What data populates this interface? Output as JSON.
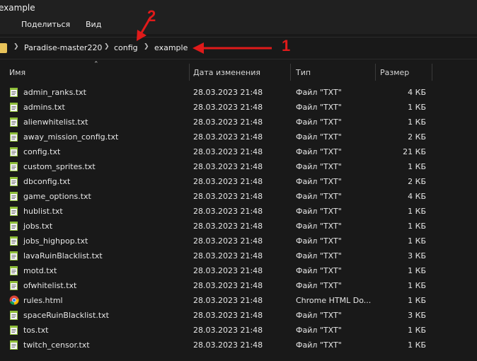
{
  "window": {
    "title": "example"
  },
  "menu": {
    "share": "Поделиться",
    "view": "Вид"
  },
  "breadcrumb": [
    "Paradise-master220",
    "config",
    "example"
  ],
  "annotations": {
    "one": "1",
    "two": "2"
  },
  "colors": {
    "annotation": "#e01a1a",
    "folder": "#e8c35a"
  },
  "columns": {
    "name": "Имя",
    "date": "Дата изменения",
    "type": "Тип",
    "size": "Размер"
  },
  "files": [
    {
      "name": "admin_ranks.txt",
      "date": "28.03.2023 21:48",
      "type": "Файл \"TXT\"",
      "size": "4 КБ",
      "icon": "text-file-icon"
    },
    {
      "name": "admins.txt",
      "date": "28.03.2023 21:48",
      "type": "Файл \"TXT\"",
      "size": "1 КБ",
      "icon": "text-file-icon"
    },
    {
      "name": "alienwhitelist.txt",
      "date": "28.03.2023 21:48",
      "type": "Файл \"TXT\"",
      "size": "1 КБ",
      "icon": "text-file-icon"
    },
    {
      "name": "away_mission_config.txt",
      "date": "28.03.2023 21:48",
      "type": "Файл \"TXT\"",
      "size": "2 КБ",
      "icon": "text-file-icon"
    },
    {
      "name": "config.txt",
      "date": "28.03.2023 21:48",
      "type": "Файл \"TXT\"",
      "size": "21 КБ",
      "icon": "text-file-icon"
    },
    {
      "name": "custom_sprites.txt",
      "date": "28.03.2023 21:48",
      "type": "Файл \"TXT\"",
      "size": "1 КБ",
      "icon": "text-file-icon"
    },
    {
      "name": "dbconfig.txt",
      "date": "28.03.2023 21:48",
      "type": "Файл \"TXT\"",
      "size": "2 КБ",
      "icon": "text-file-icon"
    },
    {
      "name": "game_options.txt",
      "date": "28.03.2023 21:48",
      "type": "Файл \"TXT\"",
      "size": "4 КБ",
      "icon": "text-file-icon"
    },
    {
      "name": "hublist.txt",
      "date": "28.03.2023 21:48",
      "type": "Файл \"TXT\"",
      "size": "1 КБ",
      "icon": "text-file-icon"
    },
    {
      "name": "jobs.txt",
      "date": "28.03.2023 21:48",
      "type": "Файл \"TXT\"",
      "size": "1 КБ",
      "icon": "text-file-icon"
    },
    {
      "name": "jobs_highpop.txt",
      "date": "28.03.2023 21:48",
      "type": "Файл \"TXT\"",
      "size": "1 КБ",
      "icon": "text-file-icon"
    },
    {
      "name": "lavaRuinBlacklist.txt",
      "date": "28.03.2023 21:48",
      "type": "Файл \"TXT\"",
      "size": "3 КБ",
      "icon": "text-file-icon"
    },
    {
      "name": "motd.txt",
      "date": "28.03.2023 21:48",
      "type": "Файл \"TXT\"",
      "size": "1 КБ",
      "icon": "text-file-icon"
    },
    {
      "name": "ofwhitelist.txt",
      "date": "28.03.2023 21:48",
      "type": "Файл \"TXT\"",
      "size": "1 КБ",
      "icon": "text-file-icon"
    },
    {
      "name": "rules.html",
      "date": "28.03.2023 21:48",
      "type": "Chrome HTML Do...",
      "size": "1 КБ",
      "icon": "chrome-icon"
    },
    {
      "name": "spaceRuinBlacklist.txt",
      "date": "28.03.2023 21:48",
      "type": "Файл \"TXT\"",
      "size": "3 КБ",
      "icon": "text-file-icon"
    },
    {
      "name": "tos.txt",
      "date": "28.03.2023 21:48",
      "type": "Файл \"TXT\"",
      "size": "1 КБ",
      "icon": "text-file-icon"
    },
    {
      "name": "twitch_censor.txt",
      "date": "28.03.2023 21:48",
      "type": "Файл \"TXT\"",
      "size": "1 КБ",
      "icon": "text-file-icon"
    }
  ]
}
